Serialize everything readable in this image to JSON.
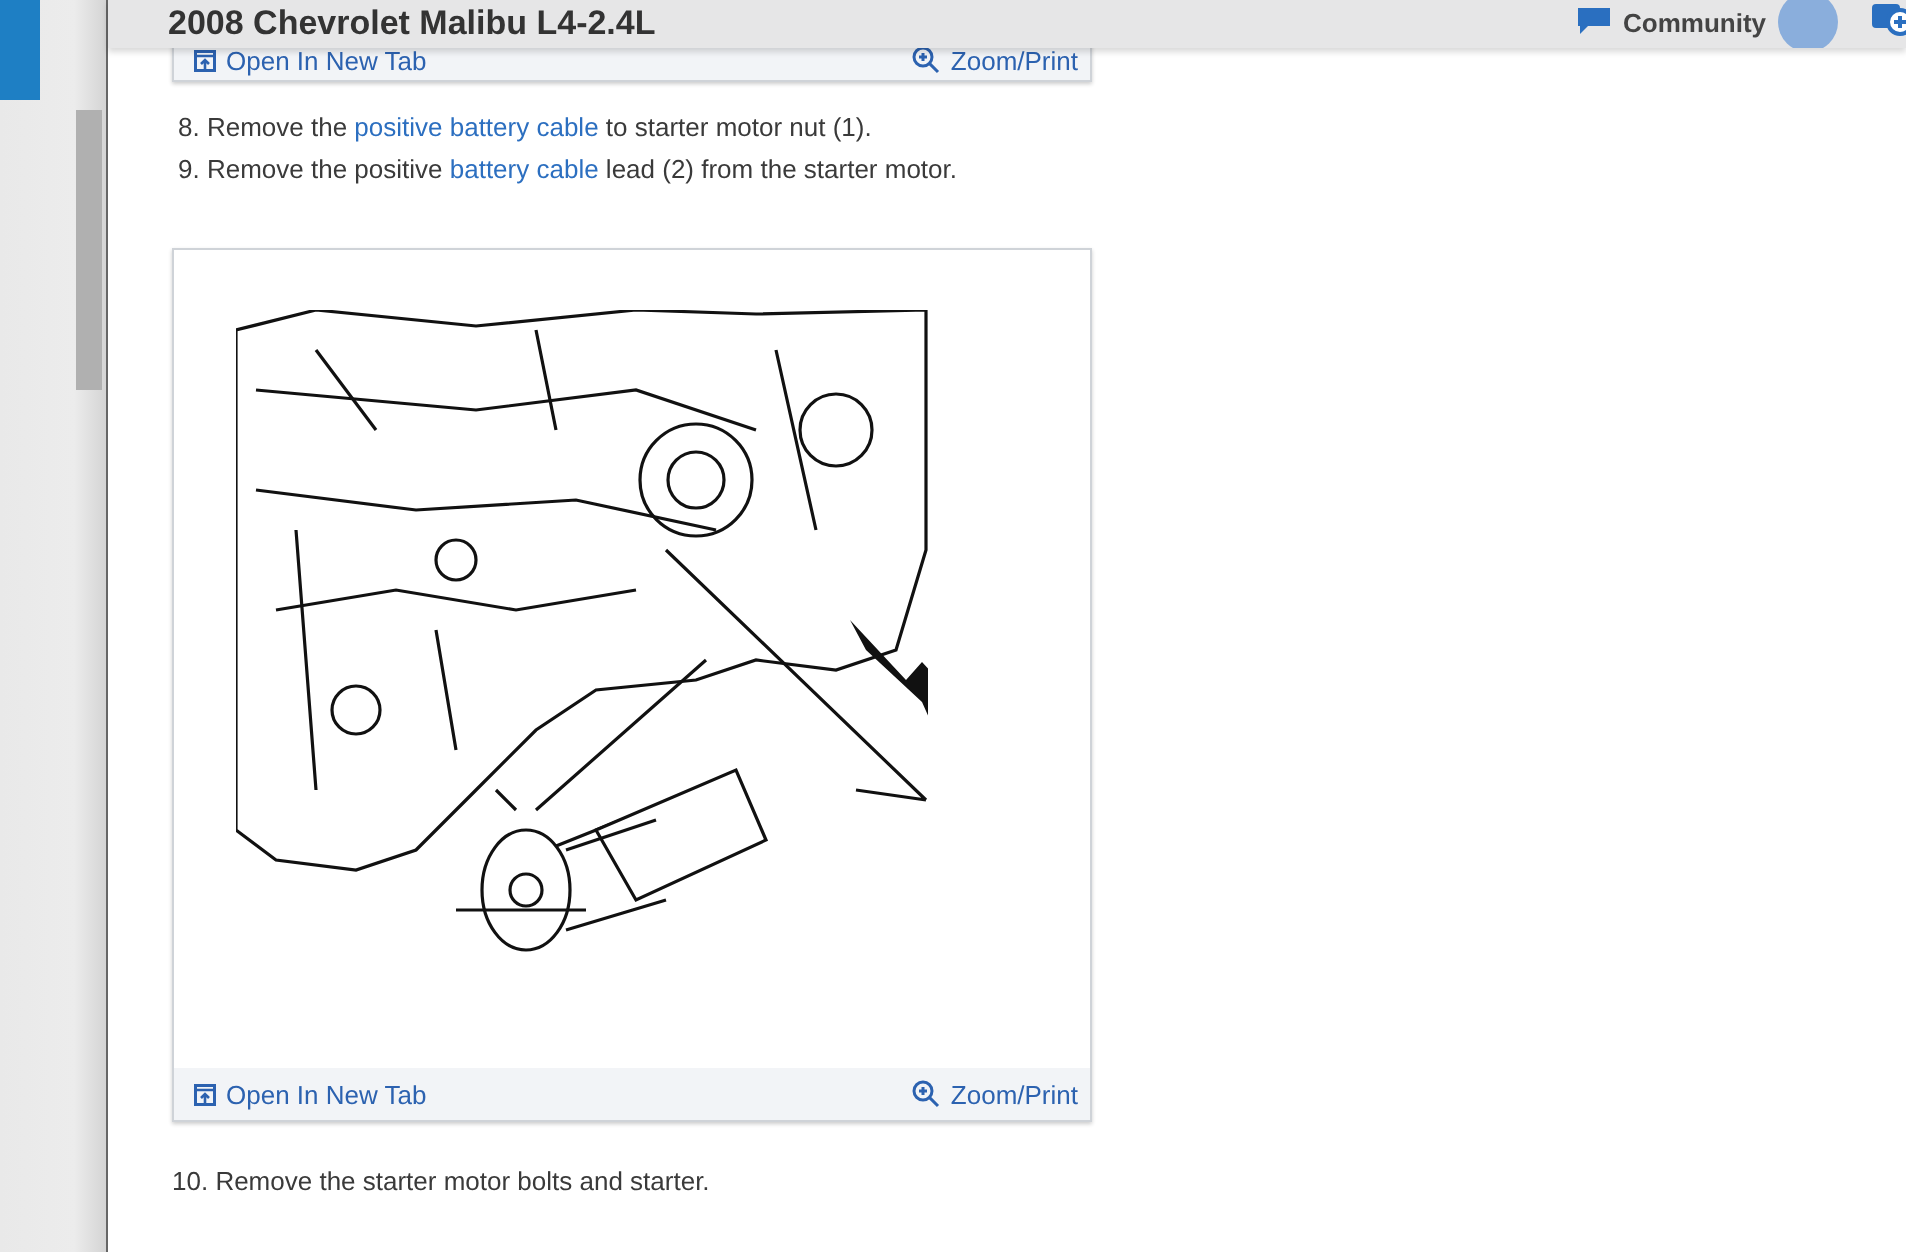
{
  "header": {
    "title": "2008 Chevrolet Malibu L4-2.4L",
    "community": "Community"
  },
  "top_figure": {
    "open_link": "Open In New Tab",
    "zoom_link": "Zoom/Print"
  },
  "steps_before": [
    {
      "number": "8.",
      "segments": [
        {
          "text": "Remove the ",
          "link": false
        },
        {
          "text": "positive battery cable",
          "link": true
        },
        {
          "text": " to starter motor nut (1).",
          "link": false
        }
      ]
    },
    {
      "number": "9.",
      "segments": [
        {
          "text": "Remove the positive ",
          "link": false
        },
        {
          "text": "battery cable",
          "link": true
        },
        {
          "text": " lead (2) from the starter motor.",
          "link": false
        }
      ]
    }
  ],
  "figure": {
    "open_link": "Open In New Tab",
    "zoom_link": "Zoom/Print"
  },
  "steps_after": [
    {
      "number": "10.",
      "segments": [
        {
          "text": "Remove the starter motor bolts and starter.",
          "link": false
        }
      ]
    }
  ]
}
